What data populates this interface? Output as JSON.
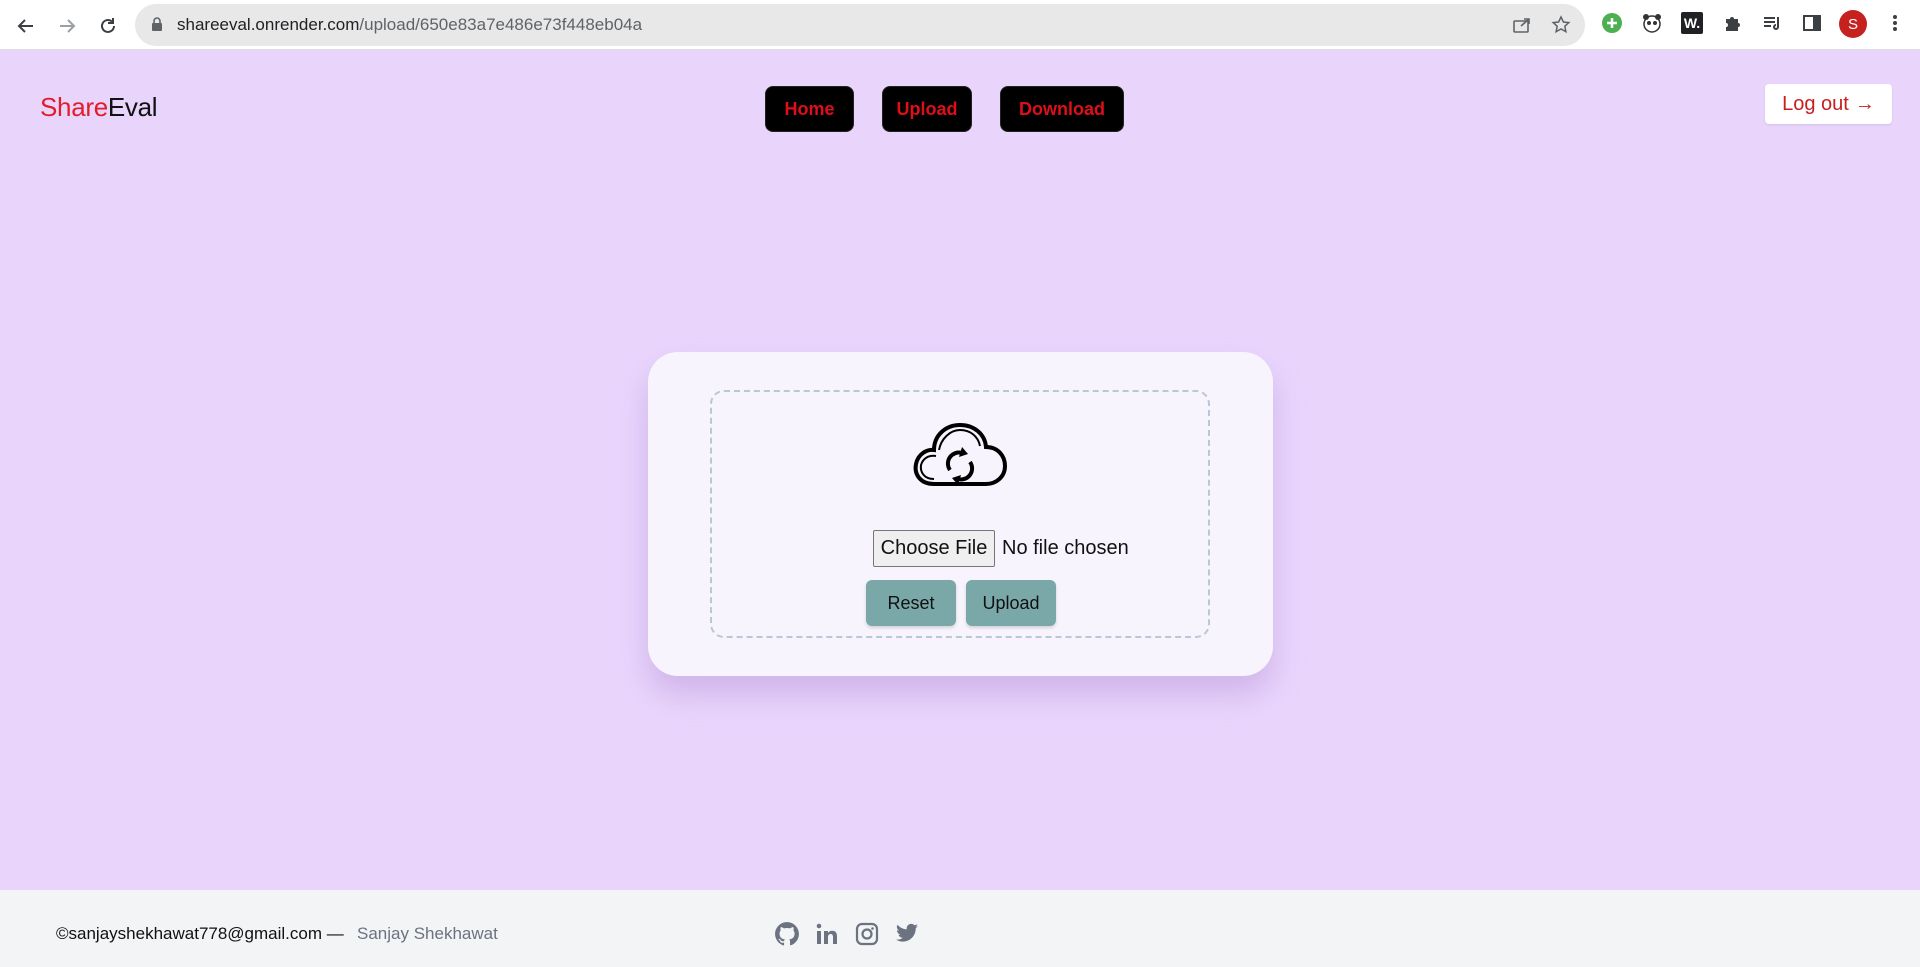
{
  "browser": {
    "url_host": "shareeval.onrender.com",
    "url_path": "/upload/650e83a7e486e73f448eb04a",
    "icons": [
      "back-icon",
      "forward-icon",
      "reload-icon",
      "lock-icon",
      "share-icon",
      "star-icon",
      "extension-green-icon",
      "panda-icon",
      "w-extension-icon",
      "puzzle-icon",
      "media-icon",
      "sidepanel-icon",
      "more-icon"
    ],
    "w_ext_label": "W.",
    "avatar_letter": "S"
  },
  "header": {
    "logo_part1": "Share",
    "logo_part2": "Eval",
    "nav": [
      "Home",
      "Upload",
      "Download"
    ],
    "logout_label": "Log out",
    "logout_arrow": "→"
  },
  "upload": {
    "icon": "cloud-sync-icon",
    "choose_file_label": "Choose File",
    "no_file_text": "No file chosen",
    "reset_label": "Reset",
    "upload_label": "Upload"
  },
  "footer": {
    "email": "©sanjayshekhawat778@gmail.com —",
    "name": "Sanjay Shekhawat",
    "social_icons": [
      "github-icon",
      "linkedin-icon",
      "instagram-icon",
      "twitter-icon"
    ]
  },
  "colors": {
    "page_bg": "#e9d5fc",
    "logo_accent": "#e11d2a",
    "nav_text": "#e00d1b",
    "button_teal": "#7aa8a8",
    "footer_bg": "#f3f4f6"
  }
}
